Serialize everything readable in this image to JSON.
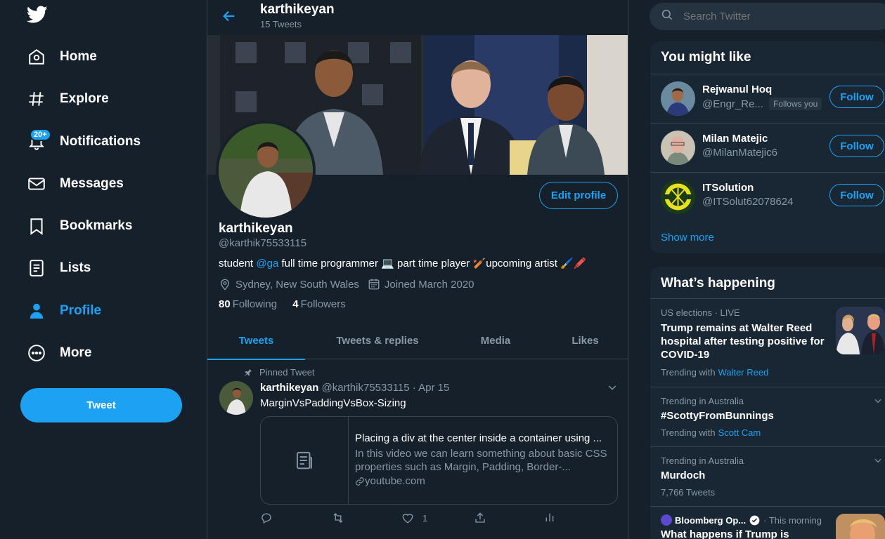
{
  "colors": {
    "accent": "#1da1f2",
    "background": "#15202b",
    "panel": "#192734",
    "muted": "#8899a6",
    "border": "#38444d"
  },
  "sidebar": {
    "logo_icon": "twitter-bird-icon",
    "items": [
      {
        "label": "Home",
        "icon": "home-icon"
      },
      {
        "label": "Explore",
        "icon": "hashtag-icon"
      },
      {
        "label": "Notifications",
        "icon": "bell-icon",
        "badge": "20+"
      },
      {
        "label": "Messages",
        "icon": "envelope-icon"
      },
      {
        "label": "Bookmarks",
        "icon": "bookmark-icon"
      },
      {
        "label": "Lists",
        "icon": "list-icon"
      },
      {
        "label": "Profile",
        "icon": "person-icon",
        "active": true
      },
      {
        "label": "More",
        "icon": "more-circle-icon"
      }
    ],
    "tweet_label": "Tweet"
  },
  "header": {
    "name": "karthikeyan",
    "tweet_count": "15 Tweets"
  },
  "profile": {
    "edit_label": "Edit profile",
    "name": "karthikeyan",
    "handle": "@karthik75533115",
    "bio_before": "student ",
    "bio_mention": "@ga",
    "bio_after": "  full time programmer 💻 part time player 🏏upcoming artist 🖌️🖍️",
    "location": "Sydney, New South Wales",
    "joined": "Joined March 2020",
    "following_count": "80",
    "following_label": "Following",
    "followers_count": "4",
    "followers_label": "Followers"
  },
  "tabs": [
    "Tweets",
    "Tweets & replies",
    "Media",
    "Likes"
  ],
  "tweet": {
    "pinned_label": "Pinned Tweet",
    "author": "karthikeyan",
    "handle": "@karthik75533115",
    "date": "· Apr 15",
    "text": "MarginVsPaddingVsBox-Sizing",
    "card_title": "Placing a div at the center inside a container using ...",
    "card_desc": "In this video we can learn something about basic CSS properties such as Margin, Padding, Border-...",
    "card_link": "youtube.com",
    "like_count": "1"
  },
  "search": {
    "placeholder": "Search Twitter"
  },
  "who_to_follow": {
    "title": "You might like",
    "users": [
      {
        "name": "Rejwanul Hoq",
        "handle": "@Engr_Re...",
        "follows_you": "Follows you",
        "button": "Follow"
      },
      {
        "name": "Milan Matejic",
        "handle": "@MilanMatejic6",
        "button": "Follow"
      },
      {
        "name": "ITSolution",
        "handle": "@ITSolut62078624",
        "button": "Follow"
      }
    ],
    "show_more": "Show more"
  },
  "happening": {
    "title": "What’s happening",
    "trends": [
      {
        "meta": "US elections · LIVE",
        "name": "Trump remains at Walter Reed hospital after testing positive for COVID-19",
        "sub": "Trending with",
        "link": "Walter Reed"
      },
      {
        "meta": "Trending in Australia",
        "name": "#ScottyFromBunnings",
        "sub": "Trending with",
        "link": "Scott Cam"
      },
      {
        "meta": "Trending in Australia",
        "name": "Murdoch",
        "sub": "7,766 Tweets"
      },
      {
        "meta_source": "Bloomberg Op...",
        "meta_time": "· This morning",
        "name": "What happens if Trump is"
      }
    ]
  }
}
